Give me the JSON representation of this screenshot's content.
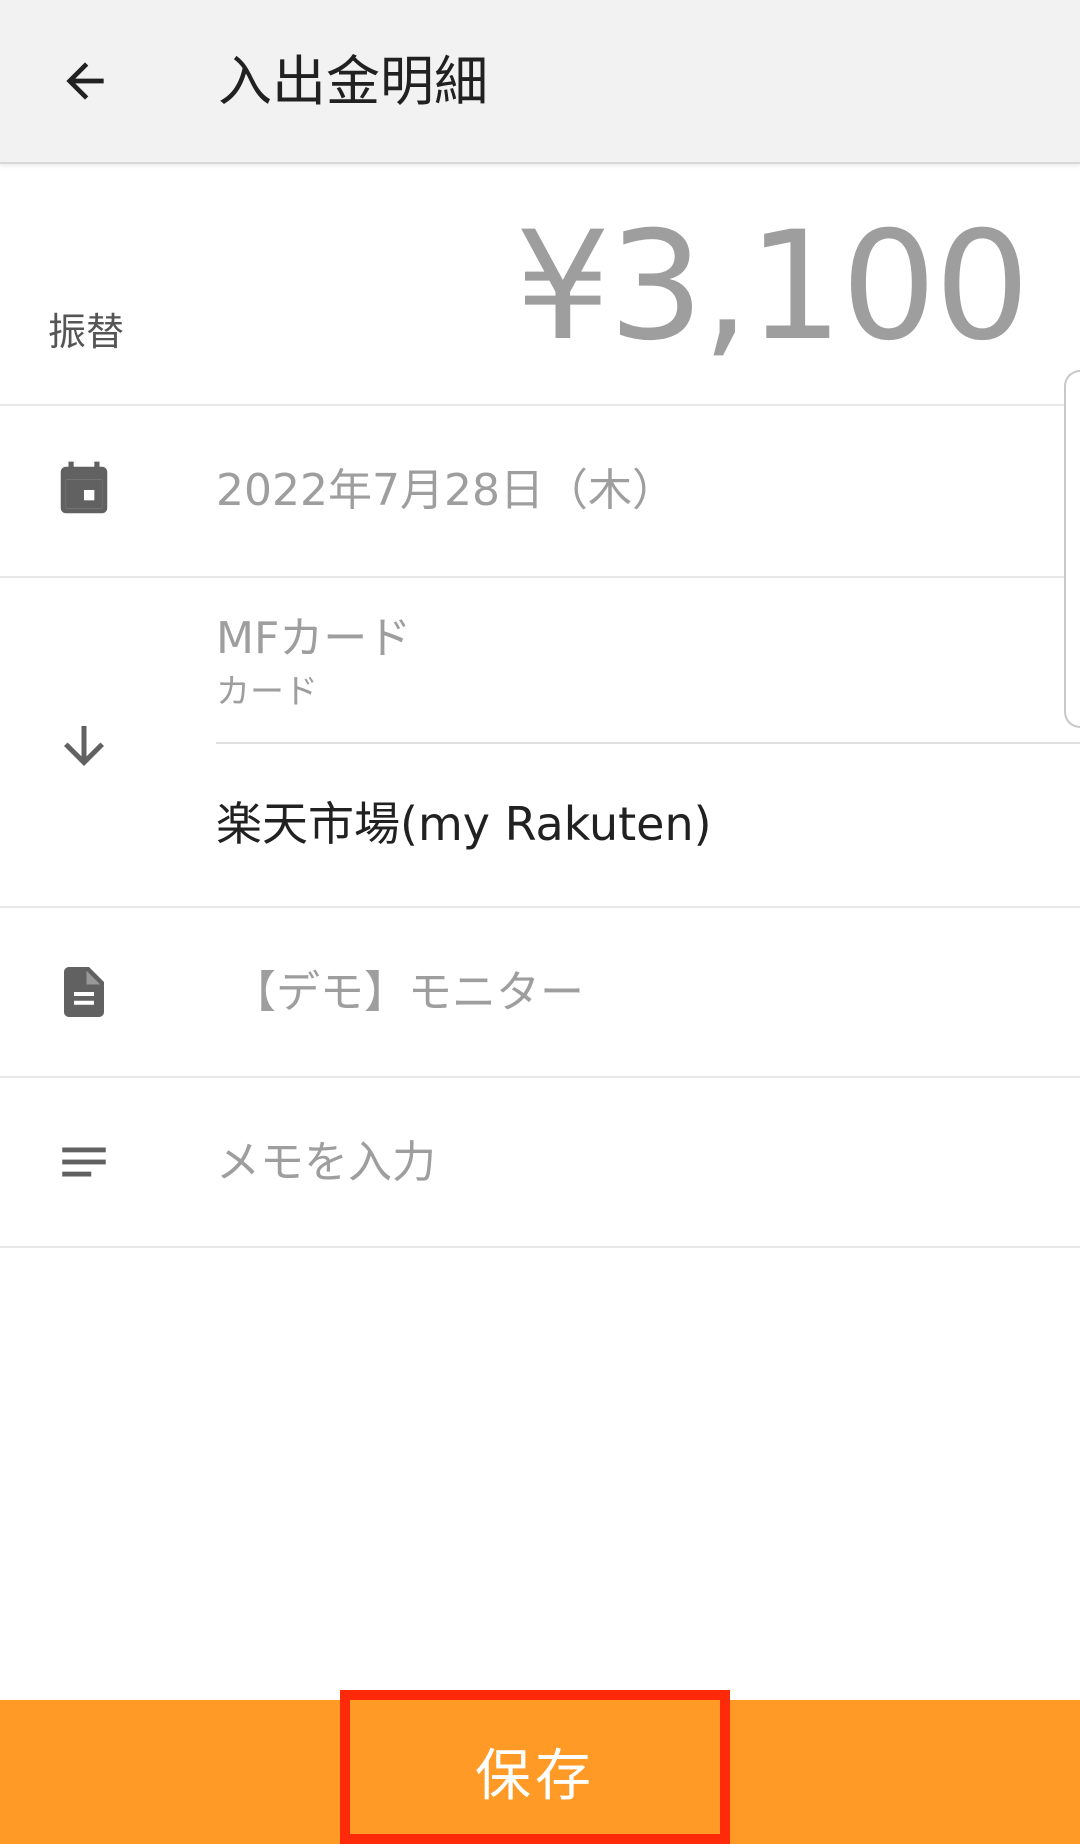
{
  "header": {
    "title": "入出金明細",
    "back_icon": "arrow-back-icon"
  },
  "transaction": {
    "category": "振替",
    "amount": "¥3,100",
    "date": "2022年7月28日（木）",
    "from_account": {
      "name": "MFカード",
      "type": "カード"
    },
    "to_account": {
      "name": "楽天市場(my Rakuten)"
    },
    "content": "【デモ】モニター",
    "memo_placeholder": "メモを入力"
  },
  "icons": {
    "date": "calendar-icon",
    "direction": "arrow-down-icon",
    "content": "document-icon",
    "memo": "notes-icon"
  },
  "footer": {
    "save_label": "保存"
  },
  "colors": {
    "accent": "#ff9a27",
    "highlight_border": "#ff2a0a",
    "muted_text": "#9e9e9e"
  }
}
